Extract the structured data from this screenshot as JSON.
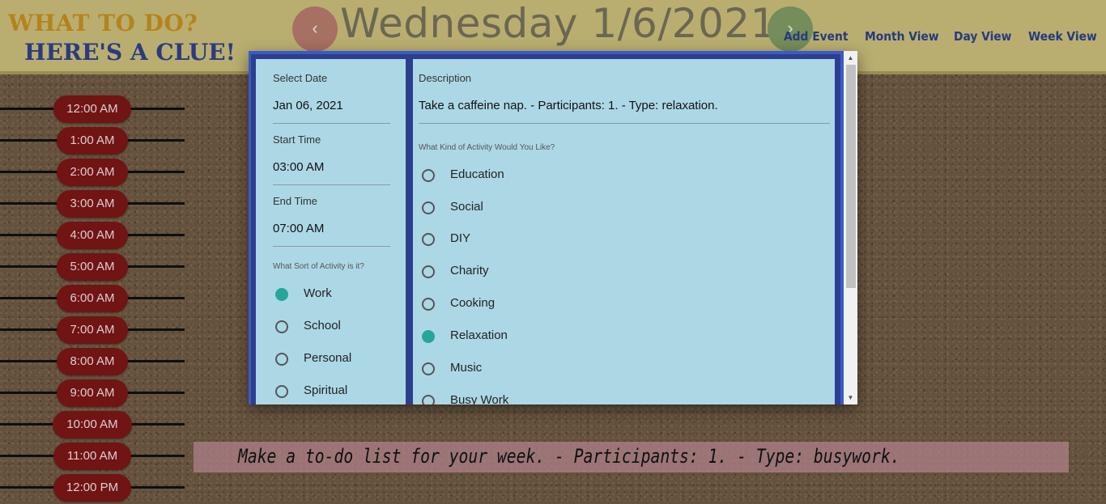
{
  "header": {
    "logo_line1": "WHAT TO DO?",
    "logo_line2": "HERE'S A CLUE!",
    "prev_label": "‹",
    "next_label": "›",
    "date_title": "Wednesday 1/6/2021",
    "nav": [
      "Add Event",
      "Month View",
      "Day View",
      "Week View"
    ]
  },
  "timeline": {
    "times": [
      "12:00 AM",
      "1:00 AM",
      "2:00 AM",
      "3:00 AM",
      "4:00 AM",
      "5:00 AM",
      "6:00 AM",
      "7:00 AM",
      "8:00 AM",
      "9:00 AM",
      "10:00 AM",
      "11:00 AM",
      "12:00 PM"
    ]
  },
  "event": {
    "text": "Make a to-do list for your week. - Participants: 1. - Type: busywork."
  },
  "modal": {
    "select_date_label": "Select Date",
    "select_date_value": "Jan 06, 2021",
    "start_time_label": "Start Time",
    "start_time_value": "03:00 AM",
    "end_time_label": "End Time",
    "end_time_value": "07:00 AM",
    "activity_sort_label": "What Sort of Activity is it?",
    "activity_sort_options": [
      {
        "label": "Work",
        "checked": true
      },
      {
        "label": "School",
        "checked": false
      },
      {
        "label": "Personal",
        "checked": false
      },
      {
        "label": "Spiritual",
        "checked": false
      }
    ],
    "description_label": "Description",
    "description_value": "Take a caffeine nap. - Participants: 1. - Type: relaxation.",
    "activity_kind_label": "What Kind of Activity Would You Like?",
    "activity_kind_options": [
      {
        "label": "Education",
        "checked": false
      },
      {
        "label": "Social",
        "checked": false
      },
      {
        "label": "DIY",
        "checked": false
      },
      {
        "label": "Charity",
        "checked": false
      },
      {
        "label": "Cooking",
        "checked": false
      },
      {
        "label": "Relaxation",
        "checked": true
      },
      {
        "label": "Music",
        "checked": false
      },
      {
        "label": "Busy Work",
        "checked": false
      }
    ],
    "scroll_up": "▲",
    "scroll_down": "▼"
  },
  "colors": {
    "header_bg": "#c9bd7a",
    "logo_gold": "#c58f1f",
    "logo_blue": "#2f3f8c",
    "time_pill": "#7a1616",
    "modal_border": "#3a5bc7",
    "panel_bg": "#acd8e6",
    "radio_checked": "#26a69a"
  }
}
